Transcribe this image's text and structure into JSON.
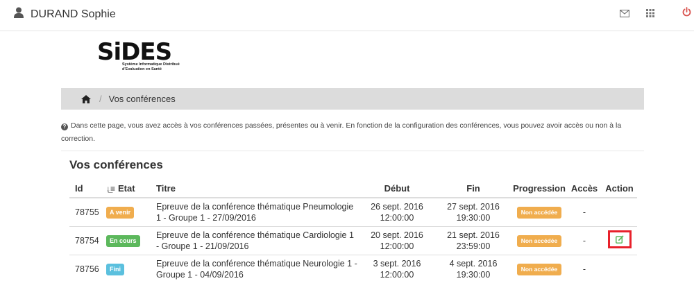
{
  "header": {
    "user_name": "DURAND Sophie",
    "icons": [
      "user-icon",
      "mail-icon",
      "apps-grid-icon",
      "power-icon"
    ]
  },
  "logo": {
    "text": "SiDES",
    "subtitle_line1": "Système Informatique Distribué",
    "subtitle_line2": "d'Evaluation en Santé"
  },
  "breadcrumb": {
    "home_icon": "home-icon",
    "separator": "/",
    "current": "Vos conférences"
  },
  "info_text": "Dans cette page, vous avez accès à vos conférences passées, présentes ou à venir. En fonction de la configuration des conférences, vous pouvez avoir accès ou non à la correction.",
  "section_title": "Vos conférences",
  "table": {
    "columns": {
      "id": "Id",
      "etat": "Etat",
      "titre": "Titre",
      "debut": "Début",
      "fin": "Fin",
      "progression": "Progression",
      "acces": "Accès",
      "action": "Action"
    },
    "rows": [
      {
        "id": "78755",
        "etat": "A venir",
        "titre": "Epreuve de la conférence thématique Pneumologie 1 - Groupe 1 - 27/09/2016",
        "debut_date": "26 sept. 2016",
        "debut_time": "12:00:00",
        "fin_date": "27 sept. 2016",
        "fin_time": "19:30:00",
        "progression": "Non accédée",
        "acces": "-"
      },
      {
        "id": "78754",
        "etat": "En cours",
        "titre": "Epreuve de la conférence thématique Cardiologie 1 - Groupe 1 - 21/09/2016",
        "debut_date": "20 sept. 2016",
        "debut_time": "12:00:00",
        "fin_date": "21 sept. 2016",
        "fin_time": "23:59:00",
        "progression": "Non accédée",
        "acces": "-"
      },
      {
        "id": "78756",
        "etat": "Fini",
        "titre": "Epreuve de la conférence thématique Neurologie 1 - Groupe 1 - 04/09/2016",
        "debut_date": "3 sept. 2016",
        "debut_time": "12:00:00",
        "fin_date": "4 sept. 2016",
        "fin_time": "19:30:00",
        "progression": "Non accédée",
        "acces": "-"
      }
    ]
  },
  "colors": {
    "a_venir": "#f0ad4e",
    "en_cours": "#5cb85c",
    "fini": "#5bc0de",
    "progression": "#f0ad4e",
    "action_highlight": "#e8212b",
    "action_icon": "#5cb85c",
    "power": "#d9534f"
  }
}
